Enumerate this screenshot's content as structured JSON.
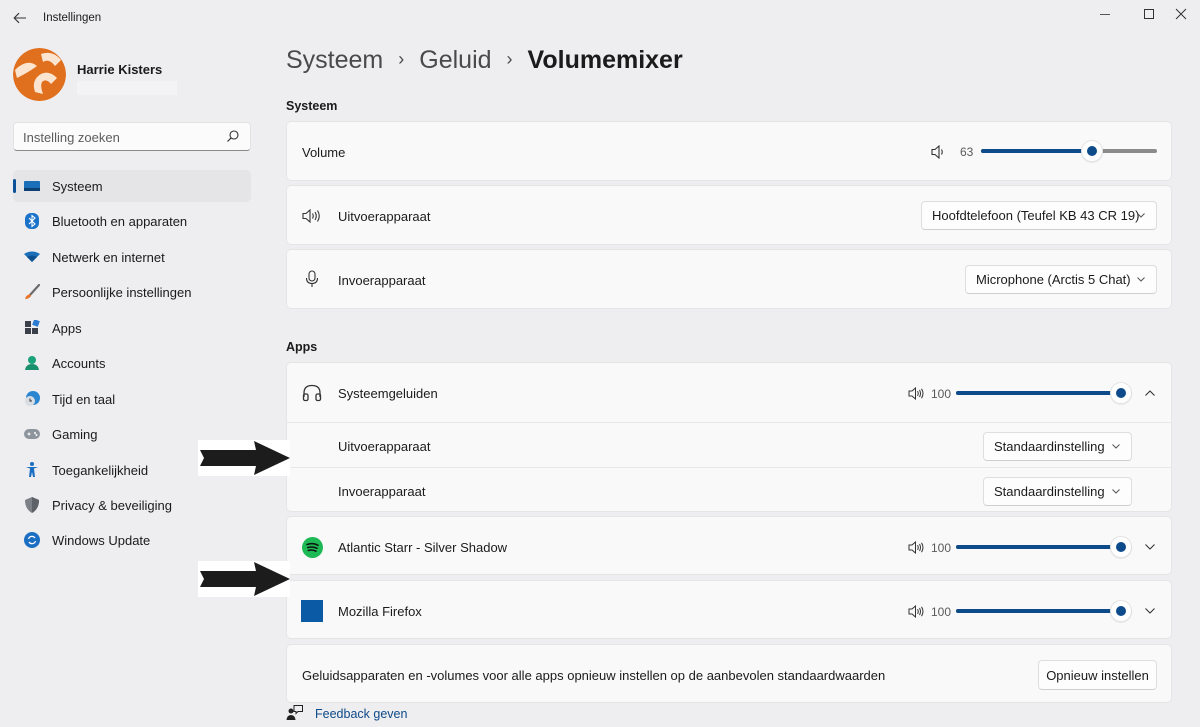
{
  "window": {
    "title": "Instellingen",
    "controls": {
      "minimize": "minimize",
      "maximize": "maximize",
      "close": "close"
    }
  },
  "profile": {
    "name": "Harrie Kisters",
    "avatar_colors": {
      "primary": "#e0701e",
      "accent": "#fbe5d0"
    }
  },
  "search": {
    "placeholder": "Instelling zoeken",
    "value": ""
  },
  "sidebar": {
    "items": [
      {
        "label": "Systeem",
        "icon": "display-icon",
        "active": true
      },
      {
        "label": "Bluetooth en apparaten",
        "icon": "bluetooth-icon",
        "active": false
      },
      {
        "label": "Netwerk en internet",
        "icon": "wifi-icon",
        "active": false
      },
      {
        "label": "Persoonlijke instellingen",
        "icon": "brush-icon",
        "active": false
      },
      {
        "label": "Apps",
        "icon": "apps-icon",
        "active": false
      },
      {
        "label": "Accounts",
        "icon": "account-icon",
        "active": false
      },
      {
        "label": "Tijd en taal",
        "icon": "clock-globe-icon",
        "active": false
      },
      {
        "label": "Gaming",
        "icon": "gamepad-icon",
        "active": false
      },
      {
        "label": "Toegankelijkheid",
        "icon": "accessibility-icon",
        "active": false
      },
      {
        "label": "Privacy & beveiliging",
        "icon": "shield-icon",
        "active": false
      },
      {
        "label": "Windows Update",
        "icon": "update-icon",
        "active": false
      }
    ]
  },
  "breadcrumb": {
    "parts": [
      "Systeem",
      "Geluid"
    ],
    "separator": "›",
    "current": "Volumemixer"
  },
  "system_section": {
    "title": "Systeem",
    "volume": {
      "label": "Volume",
      "value": 63,
      "value_text": "63"
    },
    "output": {
      "label": "Uitvoerapparaat",
      "selected": "Hoofdtelefoon (Teufel KB 43 CR 19)"
    },
    "input": {
      "label": "Invoerapparaat",
      "selected": "Microphone (Arctis 5 Chat)"
    }
  },
  "apps_section": {
    "title": "Apps",
    "apps": [
      {
        "name": "Systeemgeluiden",
        "icon": "headphones-icon",
        "volume": 100,
        "volume_text": "100",
        "expanded": true,
        "output": {
          "label": "Uitvoerapparaat",
          "selected": "Standaardinstelling"
        },
        "input": {
          "label": "Invoerapparaat",
          "selected": "Standaardinstelling"
        }
      },
      {
        "name": "Atlantic Starr - Silver Shadow",
        "icon": "spotify-icon",
        "volume": 100,
        "volume_text": "100",
        "expanded": false
      },
      {
        "name": "Mozilla Firefox",
        "icon": "firefox-app-icon",
        "volume": 100,
        "volume_text": "100",
        "expanded": false
      }
    ]
  },
  "reset": {
    "description": "Geluidsapparaten en -volumes voor alle apps opnieuw instellen op de aanbevolen standaardwaarden",
    "button_label": "Opnieuw instellen"
  },
  "feedback": {
    "label": "Feedback geven"
  },
  "colors": {
    "accent": "#0e4b8a",
    "spotify_green": "#1db954",
    "firefox_tile": "#0b5aa5",
    "background": "#eeedef",
    "card": "#f9f9f9"
  }
}
